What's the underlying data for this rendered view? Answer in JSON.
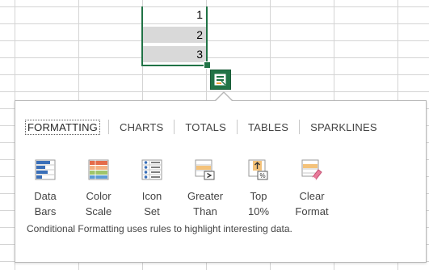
{
  "sheet": {
    "cells": [
      "1",
      "2",
      "3"
    ]
  },
  "quick_analysis": {
    "button_icon": "quick-analysis-icon",
    "tabs": [
      {
        "label": "FORMATTING",
        "active": true
      },
      {
        "label": "CHARTS",
        "active": false
      },
      {
        "label": "TOTALS",
        "active": false
      },
      {
        "label": "TABLES",
        "active": false
      },
      {
        "label": "SPARKLINES",
        "active": false
      }
    ],
    "options": [
      {
        "label": "Data Bars",
        "icon": "data-bars-icon"
      },
      {
        "label": "Color Scale",
        "icon": "color-scale-icon"
      },
      {
        "label": "Icon Set",
        "icon": "icon-set-icon"
      },
      {
        "label": "Greater Than",
        "icon": "greater-than-icon"
      },
      {
        "label": "Top 10%",
        "icon": "top-10-percent-icon"
      },
      {
        "label": "Clear Format",
        "icon": "clear-format-icon"
      }
    ],
    "description": "Conditional Formatting uses rules to highlight interesting data."
  },
  "colors": {
    "accent": "#217346",
    "selection_fill": "#d9d9d9",
    "gridline": "#d4d4d4"
  }
}
